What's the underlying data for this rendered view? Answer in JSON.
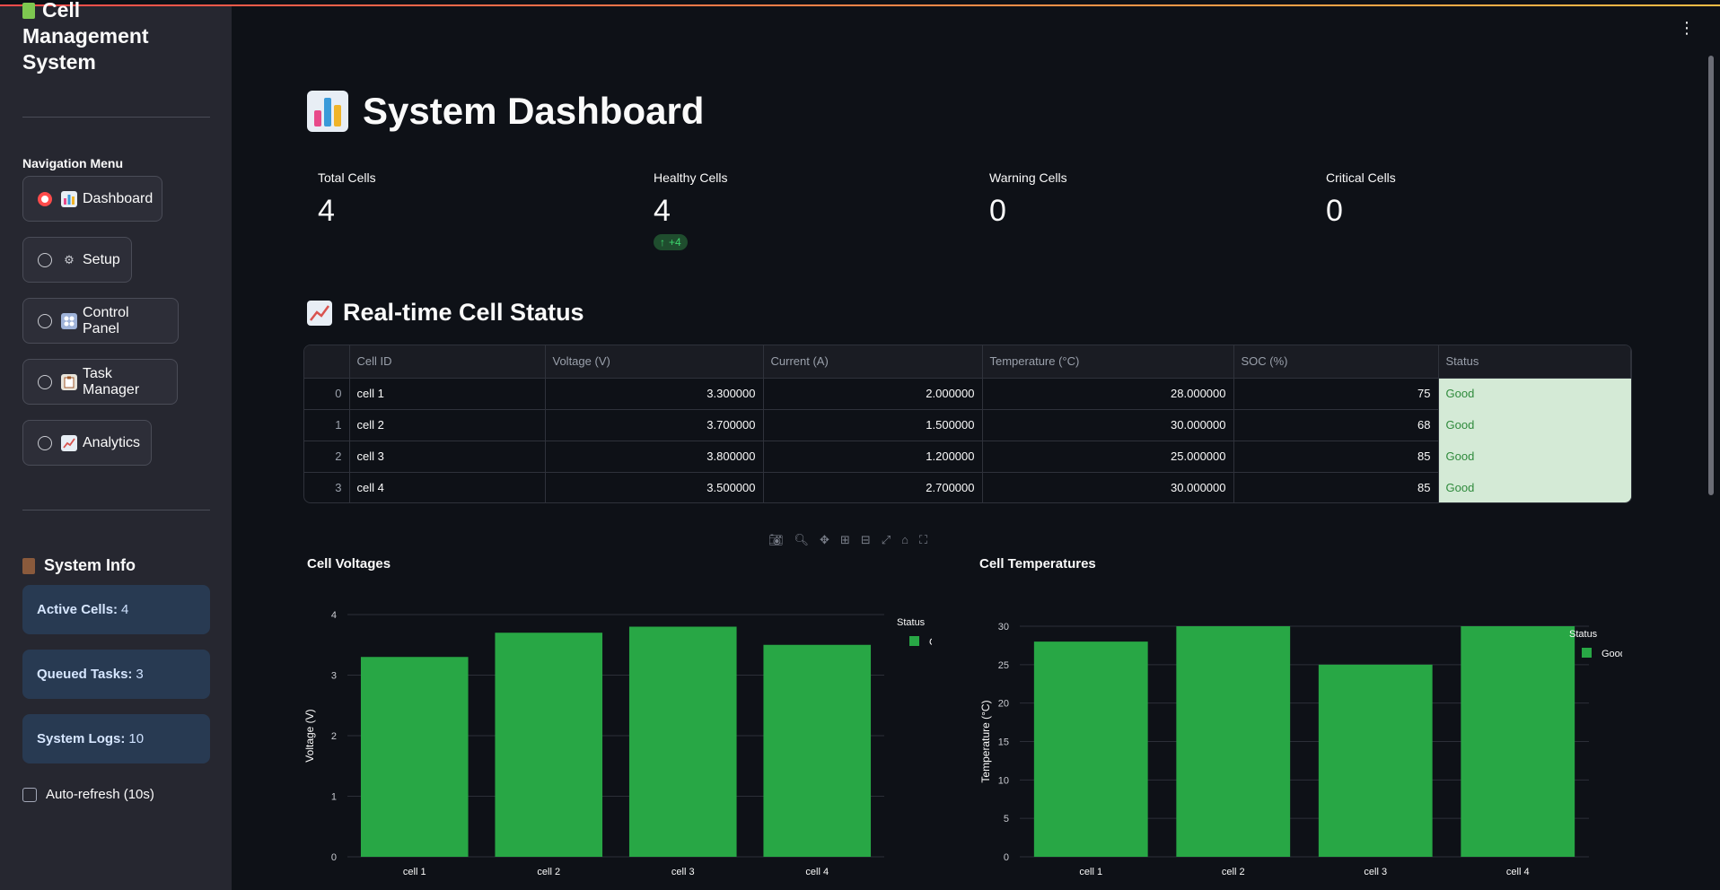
{
  "sidebar": {
    "title_line1": "Cell",
    "title_line2": "Management",
    "title_line3": "System",
    "nav_label": "Navigation Menu",
    "nav_items": [
      {
        "label": "Dashboard",
        "icon": "bar-chart-icon",
        "selected": true
      },
      {
        "label": "Setup",
        "icon": "gear-icon",
        "selected": false
      },
      {
        "label": "Control Panel",
        "icon": "control-knobs-icon",
        "selected": false
      },
      {
        "label": "Task Manager",
        "icon": "clipboard-icon",
        "selected": false
      },
      {
        "label": "Analytics",
        "icon": "trend-chart-icon",
        "selected": false
      }
    ],
    "system_info_title": "System Info",
    "info": {
      "active_label": "Active Cells:",
      "active_value": "4",
      "queued_label": "Queued Tasks:",
      "queued_value": "3",
      "logs_label": "System Logs:",
      "logs_value": "10"
    },
    "auto_refresh_label": "Auto-refresh (10s)"
  },
  "main": {
    "title": "System Dashboard",
    "metrics": [
      {
        "label": "Total Cells",
        "value": "4"
      },
      {
        "label": "Healthy Cells",
        "value": "4",
        "delta": "+4"
      },
      {
        "label": "Warning Cells",
        "value": "0"
      },
      {
        "label": "Critical Cells",
        "value": "0"
      }
    ],
    "section_title": "Real-time Cell Status",
    "table": {
      "columns": [
        "",
        "Cell ID",
        "Voltage (V)",
        "Current (A)",
        "Temperature (°C)",
        "SOC (%)",
        "Status"
      ],
      "rows": [
        [
          "0",
          "cell 1",
          "3.300000",
          "2.000000",
          "28.000000",
          "75",
          "Good"
        ],
        [
          "1",
          "cell 2",
          "3.700000",
          "1.500000",
          "30.000000",
          "68",
          "Good"
        ],
        [
          "2",
          "cell 3",
          "3.800000",
          "1.200000",
          "25.000000",
          "85",
          "Good"
        ],
        [
          "3",
          "cell 4",
          "3.500000",
          "2.700000",
          "30.000000",
          "85",
          "Good"
        ]
      ]
    }
  },
  "colors": {
    "accent": "#ff4b4b",
    "bar": "#28a745",
    "status_bg": "#d4ead6"
  },
  "chart_data": [
    {
      "type": "bar",
      "title": "Cell Voltages",
      "categories": [
        "cell 1",
        "cell 2",
        "cell 3",
        "cell 4"
      ],
      "series": [
        {
          "name": "Good",
          "values": [
            3.3,
            3.7,
            3.8,
            3.5
          ]
        }
      ],
      "xlabel": "",
      "ylabel": "Voltage (V)",
      "ylim": [
        0,
        4
      ],
      "yticks": [
        0,
        1,
        2,
        3,
        4
      ],
      "legend_title": "Status",
      "legend_position": "top-right",
      "grid": true
    },
    {
      "type": "bar",
      "title": "Cell Temperatures",
      "categories": [
        "cell 1",
        "cell 2",
        "cell 3",
        "cell 4"
      ],
      "series": [
        {
          "name": "Good",
          "values": [
            28,
            30,
            25,
            30
          ]
        }
      ],
      "xlabel": "",
      "ylabel": "Temperature (°C)",
      "ylim": [
        0,
        30
      ],
      "yticks": [
        0,
        5,
        10,
        15,
        20,
        25,
        30
      ],
      "legend_title": "Status",
      "legend_position": "top-right",
      "grid": true
    }
  ]
}
